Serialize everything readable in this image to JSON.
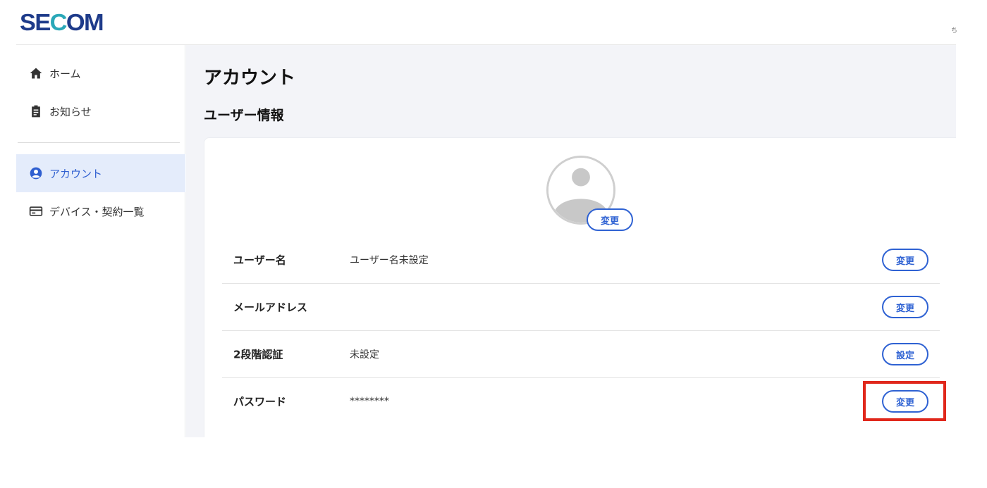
{
  "header": {
    "logo_part1": "SE",
    "logo_part2": "C",
    "logo_part3": "OM",
    "corner_glyph": "ち"
  },
  "sidebar": {
    "items": [
      {
        "label": "ホーム",
        "icon": "home-icon"
      },
      {
        "label": "お知らせ",
        "icon": "clipboard-icon"
      },
      {
        "label": "アカウント",
        "icon": "account-circle-icon",
        "active": true
      },
      {
        "label": "デバイス・契約一覧",
        "icon": "card-icon"
      }
    ]
  },
  "main": {
    "title": "アカウント",
    "section_title": "ユーザー情報",
    "avatar": {
      "button_label": "変更"
    },
    "rows": [
      {
        "label": "ユーザー名",
        "value": "ユーザー名未設定",
        "button": "変更"
      },
      {
        "label": "メールアドレス",
        "value": "",
        "button": "変更"
      },
      {
        "label": "2段階認証",
        "value": "未設定",
        "button": "設定"
      },
      {
        "label": "パスワード",
        "value": "********",
        "button": "変更"
      }
    ]
  },
  "colors": {
    "accent": "#2f62d3",
    "logo_navy": "#1e3b8a",
    "logo_teal": "#2aa8b8",
    "active_bg": "#e4ecfb",
    "highlight": "#e0281c",
    "main_bg": "#f3f4f8"
  }
}
